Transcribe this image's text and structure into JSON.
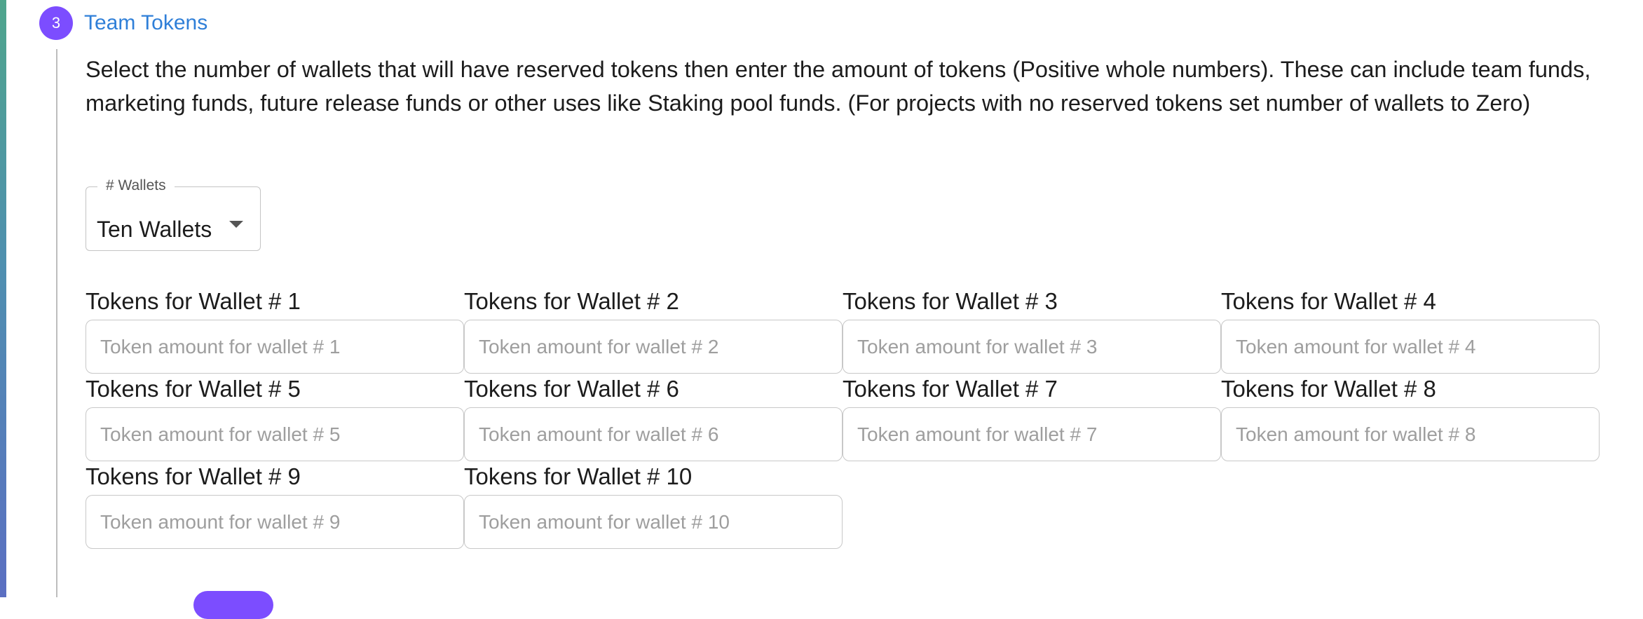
{
  "step": {
    "number": "3",
    "title": "Team Tokens",
    "description": "Select the number of wallets that will have reserved tokens then enter the amount of tokens (Positive whole numbers). These can include team funds, marketing funds, future release funds or other uses like Staking pool funds. (For projects with no reserved tokens set number of wallets to Zero)"
  },
  "wallet_count_select": {
    "label": "# Wallets",
    "value": "Ten Wallets"
  },
  "wallets": [
    {
      "label": "Tokens for Wallet # 1",
      "placeholder": "Token amount for wallet # 1"
    },
    {
      "label": "Tokens for Wallet # 2",
      "placeholder": "Token amount for wallet # 2"
    },
    {
      "label": "Tokens for Wallet # 3",
      "placeholder": "Token amount for wallet # 3"
    },
    {
      "label": "Tokens for Wallet # 4",
      "placeholder": "Token amount for wallet # 4"
    },
    {
      "label": "Tokens for Wallet # 5",
      "placeholder": "Token amount for wallet # 5"
    },
    {
      "label": "Tokens for Wallet # 6",
      "placeholder": "Token amount for wallet # 6"
    },
    {
      "label": "Tokens for Wallet # 7",
      "placeholder": "Token amount for wallet # 7"
    },
    {
      "label": "Tokens for Wallet # 8",
      "placeholder": "Token amount for wallet # 8"
    },
    {
      "label": "Tokens for Wallet # 9",
      "placeholder": "Token amount for wallet # 9"
    },
    {
      "label": "Tokens for Wallet # 10",
      "placeholder": "Token amount for wallet # 10"
    }
  ],
  "colors": {
    "accent": "#7c4dff",
    "title_blue": "#2f7fd8",
    "border": "#c8c8c8"
  },
  "icons": {
    "select_caret": "caret-down-icon"
  }
}
